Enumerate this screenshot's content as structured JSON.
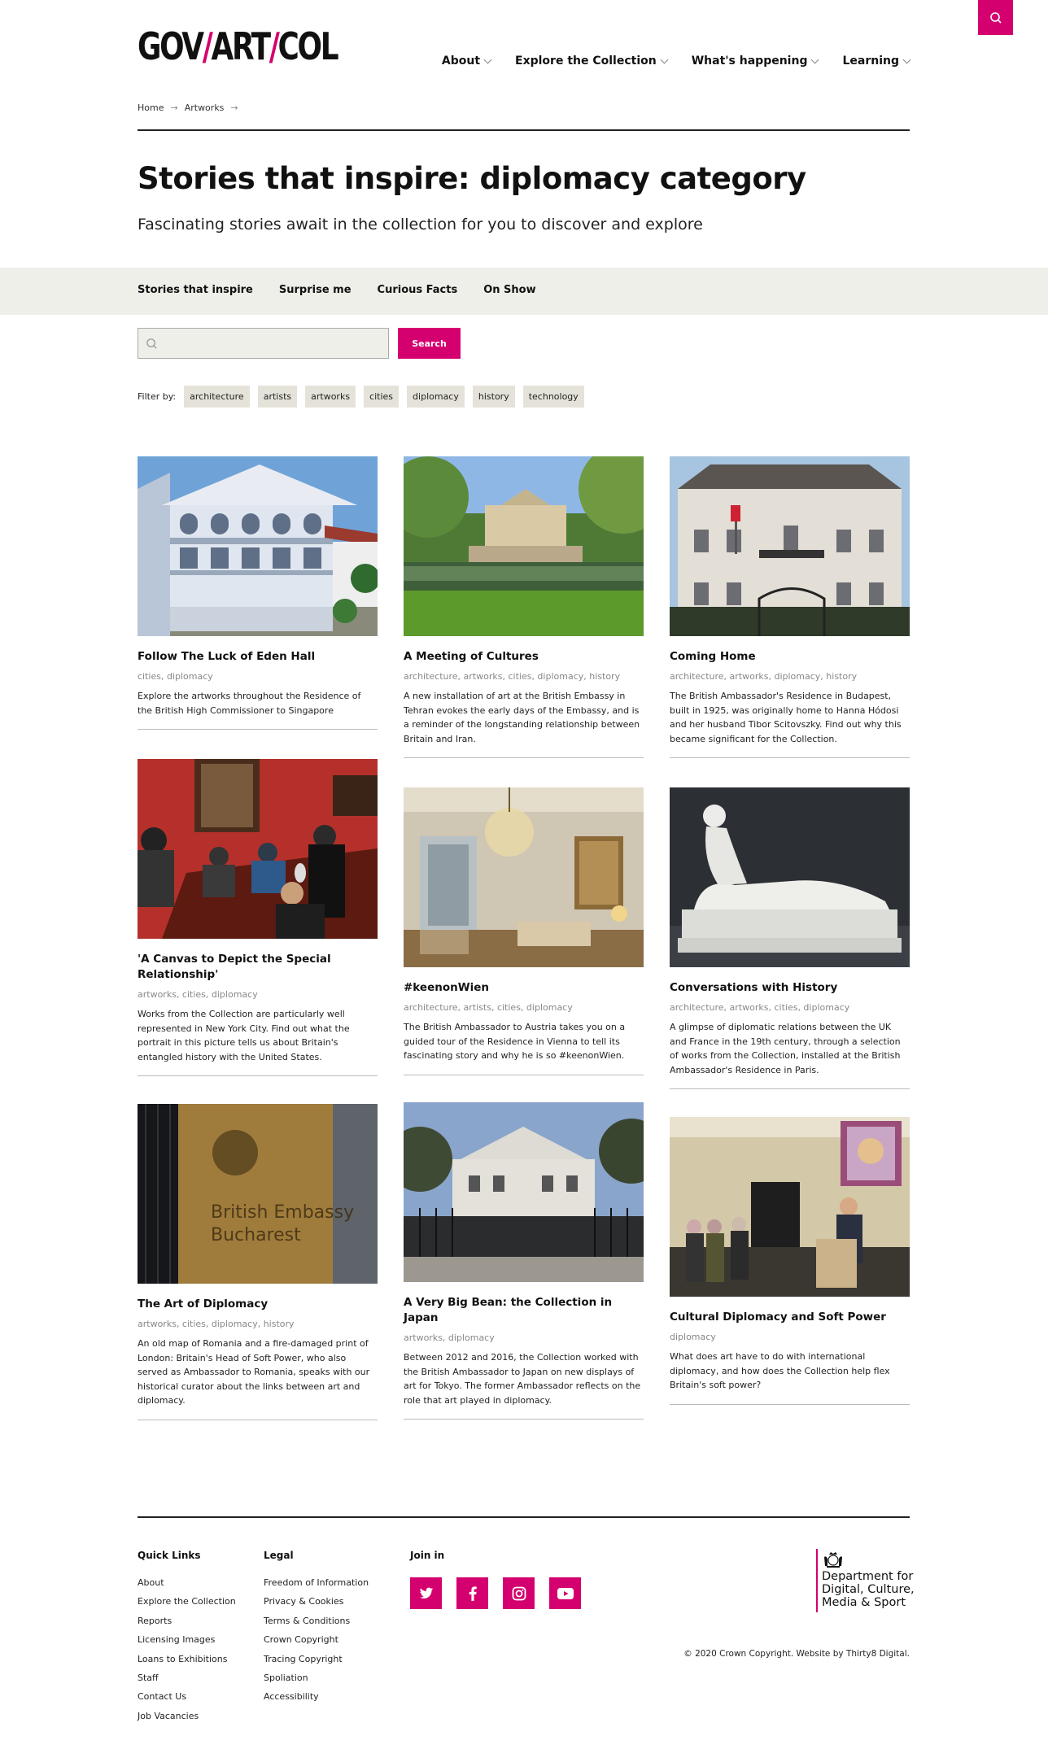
{
  "header": {
    "logo": {
      "part1": "GOV",
      "slash1": "/",
      "part2": "ART",
      "slash2": "/",
      "part3": "COL"
    },
    "nav": [
      "About",
      "Explore the Collection",
      "What's happening",
      "Learning"
    ]
  },
  "breadcrumb": [
    "Home",
    "Artworks"
  ],
  "page": {
    "title": "Stories that inspire: diplomacy category",
    "subtitle": "Fascinating stories await in the collection for you to discover and explore"
  },
  "subnav": [
    "Stories that inspire",
    "Surprise me",
    "Curious Facts",
    "On Show"
  ],
  "search": {
    "placeholder": "",
    "button_label": "Search"
  },
  "filter": {
    "label": "Filter by:",
    "tags": [
      "architecture",
      "artists",
      "artworks",
      "cities",
      "diplomacy",
      "history",
      "technology"
    ]
  },
  "cards": [
    {
      "title": "Follow The Luck of Eden Hall",
      "categories": "cities, diplomacy",
      "description": "Explore the artworks throughout the Residence of the British High Commissioner to Singapore"
    },
    {
      "title": "A Meeting of Cultures",
      "categories": "architecture, artworks, cities, diplomacy, history",
      "description": "A new installation of art at the British Embassy in Tehran evokes the early days of the Embassy, and is a reminder of the longstanding relationship between Britain and Iran."
    },
    {
      "title": "Coming Home",
      "categories": "architecture, artworks, diplomacy, history",
      "description": "The British Ambassador's Residence in Budapest, built in 1925, was originally home to Hanna Hódosi and her husband Tibor Scitovszky. Find out why this became significant for the Collection."
    },
    {
      "title": "'A Canvas to Depict the Special Relationship'",
      "categories": "artworks, cities, diplomacy",
      "description": "Works from the Collection are particularly well represented in New York City. Find out what the portrait in this picture tells us about Britain's entangled history with the United States."
    },
    {
      "title": "#keenonWien",
      "categories": "architecture, artists, cities, diplomacy",
      "description": "The British Ambassador to Austria takes you on a guided tour of the Residence in Vienna to tell its fascinating story and why he is so #keenonWien."
    },
    {
      "title": "Conversations with History",
      "categories": "architecture, artworks, cities, diplomacy",
      "description": "A glimpse of diplomatic relations between the UK and France in the 19th century, through a selection of works from the Collection, installed at the British Ambassador's Residence in Paris."
    },
    {
      "title": "The Art of Diplomacy",
      "categories": "artworks, cities, diplomacy, history",
      "description": "An old map of Romania and a fire-damaged print of London: Britain's Head of Soft Power, who also served as Ambassador to Romania, speaks with our historical curator about the links between art and diplomacy.",
      "image_text": "British Embassy Bucharest"
    },
    {
      "title": "A Very Big Bean: the Collection in Japan",
      "categories": "artworks, diplomacy",
      "description": "Between 2012 and 2016, the Collection worked with the British Ambassador to Japan on new displays of art for Tokyo. The former Ambassador reflects on the role that art played in diplomacy."
    },
    {
      "title": "Cultural Diplomacy and Soft Power",
      "categories": "diplomacy",
      "description": "What does art have to do with international diplomacy, and how does the Collection help flex Britain's soft power?"
    }
  ],
  "footer": {
    "quick_links": {
      "heading": "Quick Links",
      "items": [
        "About",
        "Explore the Collection",
        "Reports",
        "Licensing Images",
        "Loans to Exhibitions",
        "Staff",
        "Contact Us",
        "Job Vacancies"
      ]
    },
    "legal": {
      "heading": "Legal",
      "items": [
        "Freedom of Information",
        "Privacy & Cookies",
        "Terms & Conditions",
        "Crown Copyright",
        "Tracing Copyright",
        "Spoliation",
        "Accessibility"
      ]
    },
    "join": {
      "heading": "Join in",
      "icons": [
        "twitter-icon",
        "facebook-icon",
        "instagram-icon",
        "youtube-icon"
      ]
    },
    "department": [
      "Department for",
      "Digital, Culture,",
      "Media & Sport"
    ],
    "copyright": "© 2020 Crown Copyright. Website by Thirty8 Digital."
  },
  "colors": {
    "accent": "#d4006f",
    "band": "#efefea",
    "tag": "#e5e3d9"
  }
}
